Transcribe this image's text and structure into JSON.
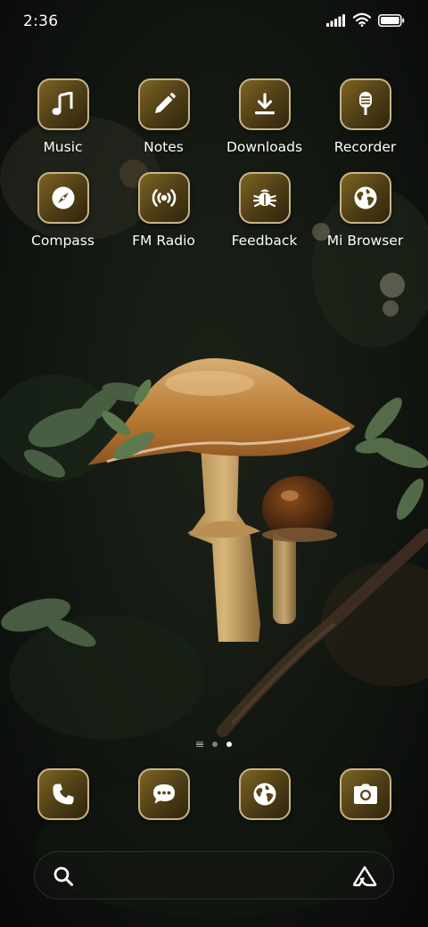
{
  "status_bar": {
    "time": "2:36",
    "icons": [
      "signal-icon",
      "wifi-icon",
      "battery-icon"
    ]
  },
  "home_apps": [
    {
      "label": "Music",
      "icon": "music-note-icon"
    },
    {
      "label": "Notes",
      "icon": "pencil-icon"
    },
    {
      "label": "Downloads",
      "icon": "download-icon"
    },
    {
      "label": "Recorder",
      "icon": "microphone-icon"
    },
    {
      "label": "Compass",
      "icon": "compass-icon"
    },
    {
      "label": "FM Radio",
      "icon": "radio-broadcast-icon"
    },
    {
      "label": "Feedback",
      "icon": "bug-icon"
    },
    {
      "label": "Mi Browser",
      "icon": "globe-icon"
    }
  ],
  "page_indicator": {
    "pages": [
      "list",
      "page",
      "page"
    ],
    "active_index": 2
  },
  "dock": [
    {
      "name": "phone",
      "icon": "phone-icon"
    },
    {
      "name": "messages",
      "icon": "chat-bubble-icon"
    },
    {
      "name": "browser",
      "icon": "globe-icon"
    },
    {
      "name": "camera",
      "icon": "camera-icon"
    }
  ],
  "search_bar": {
    "left_icon": "search-icon",
    "right_icon": "assistant-icon"
  },
  "colors": {
    "icon_gradient_start": "#7d6422",
    "icon_gradient_end": "#2f260d",
    "icon_border": "#c8b48a",
    "text": "#ffffff"
  }
}
